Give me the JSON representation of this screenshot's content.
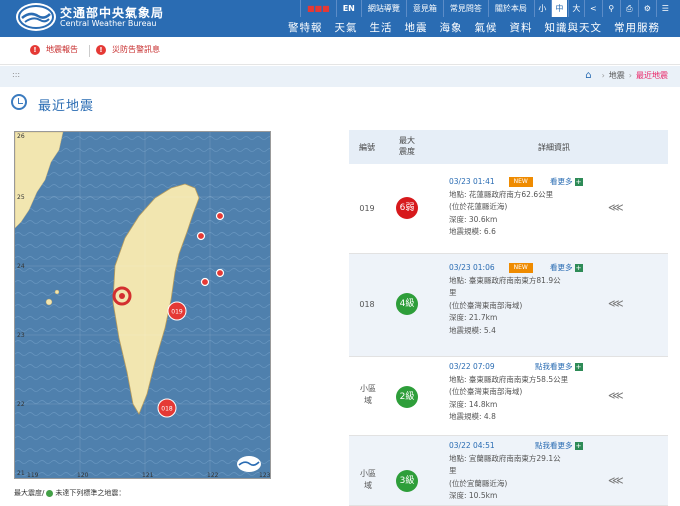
{
  "header": {
    "brand_zh": "交通部中央氣象局",
    "brand_en": "Central Weather Bureau",
    "top_links": [
      "EN",
      "網站導覽",
      "意見箱",
      "常見問答",
      "關於本局"
    ],
    "font_sizes": [
      "小",
      "中",
      "大"
    ],
    "nav": [
      "警特報",
      "天氣",
      "生活",
      "地震",
      "海象",
      "氣候",
      "資料",
      "知識與天文",
      "常用服務"
    ]
  },
  "alerts": [
    {
      "label": "地震報告"
    },
    {
      "label": "災防告警訊息"
    }
  ],
  "breadcrumb": {
    "level1": "地震",
    "level2": "最近地震"
  },
  "page": {
    "title": "最近地震"
  },
  "map": {
    "x_ticks": [
      "119",
      "120",
      "121",
      "122",
      "123"
    ],
    "y_ticks": [
      "26",
      "25",
      "24",
      "23",
      "22",
      "21"
    ],
    "markers": [
      "019",
      "018"
    ],
    "legend": {
      "prefix": "最大震度/",
      "suffix": "未達下列標準之地震："
    }
  },
  "table": {
    "headers": {
      "id": "編號",
      "intensity": "最大\n震度",
      "details": "詳細資訊"
    },
    "rows": [
      {
        "id": "019",
        "intensity": "6弱",
        "color": "#d7191c",
        "time": "03/23 01:41",
        "is_new": true,
        "new_label": "NEW",
        "more": "看更多",
        "location": "地點: 花蓮縣政府南方62.6公里",
        "location2": "(位於花蓮縣近海)",
        "depth": "深度: 30.6km",
        "magnitude": "地震規模: 6.6"
      },
      {
        "id": "018",
        "intensity": "4級",
        "color": "#2e9e3a",
        "time": "03/23 01:06",
        "is_new": true,
        "new_label": "NEW",
        "more": "看更多",
        "location": "地點: 臺東縣政府南南東方81.9公",
        "location2": "里",
        "location3": "(位於臺灣東南部海域)",
        "depth": "深度: 21.7km",
        "magnitude": "地震規模: 5.4"
      },
      {
        "id": "小區域",
        "intensity": "2級",
        "color": "#2e9e3a",
        "time": "03/22 07:09",
        "is_new": false,
        "more": "點我看更多",
        "location": "地點: 臺東縣政府南南東方58.5公里",
        "location2": "(位於臺灣東南部海域)",
        "depth": "深度: 14.8km",
        "magnitude": "地震規模: 4.8"
      },
      {
        "id": "小區域",
        "intensity": "3級",
        "color": "#2e9e3a",
        "time": "03/22 04:51",
        "is_new": false,
        "more": "點我看更多",
        "location": "地點: 宜蘭縣政府南南東方29.1公",
        "location2": "里",
        "location3": "(位於宜蘭縣近海)",
        "depth": "深度: 10.5km"
      }
    ]
  }
}
